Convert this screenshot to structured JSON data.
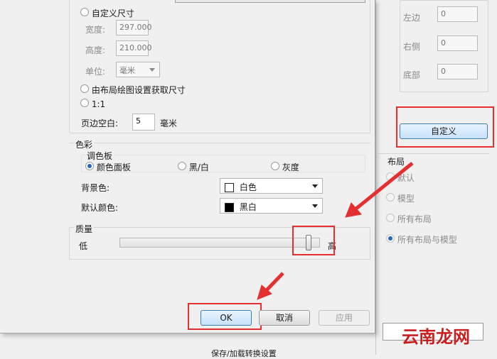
{
  "paper": {
    "custom_size_label": "自定义尺寸",
    "width_label": "宽度:",
    "width_value": "297.000",
    "height_label": "高度:",
    "height_value": "210.000",
    "unit_label": "单位:",
    "unit_value": "毫米",
    "from_layout_label": "由布局绘图设置获取尺寸",
    "one_to_one_label": "1:1",
    "margin_label": "页边空白:",
    "margin_value": "5",
    "margin_unit": "毫米"
  },
  "color": {
    "group_title": "色彩",
    "palette_title": "调色板",
    "palette_options": [
      "颜色面板",
      "黑/白",
      "灰度"
    ],
    "palette_selected": 0,
    "bg_label": "背景色:",
    "bg_value": "白色",
    "bg_swatch": "#ffffff",
    "default_color_label": "默认颜色:",
    "default_color_value": "黑白",
    "default_swatch": "#000000"
  },
  "quality": {
    "group_title": "质量",
    "low_label": "低",
    "high_label": "高",
    "level": 1.0
  },
  "buttons": {
    "ok": "OK",
    "cancel": "取消",
    "apply": "应用"
  },
  "right_panel": {
    "left_label": "左边",
    "left_value": "0",
    "right_label": "右侧",
    "right_value": "0",
    "bottom_label": "底部",
    "bottom_value": "0",
    "custom_button": "自定义",
    "layout_title": "布局",
    "layout_options": [
      "默认",
      "模型",
      "所有布局",
      "所有布局与模型"
    ],
    "layout_selected": 3
  },
  "bottom_text": "保存/加载转换设置",
  "watermark": "云南龙网",
  "colors": {
    "annotation_red": "#e53030",
    "accent_blue": "#2b64c0"
  }
}
